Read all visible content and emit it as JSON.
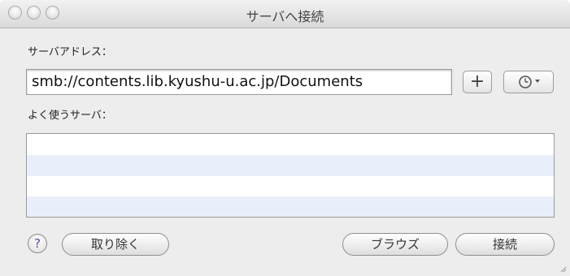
{
  "window": {
    "title": "サーバへ接続"
  },
  "labels": {
    "server_address": "サーバアドレス：",
    "favorite_servers": "よく使うサーバ："
  },
  "address": {
    "value": "smb://contents.lib.kyushu-u.ac.jp/Documents"
  },
  "buttons": {
    "add": "+",
    "help": "?",
    "remove": "取り除く",
    "browse": "ブラウズ",
    "connect": "接続"
  },
  "icons": {
    "add_favorite": "plus-icon",
    "recent_servers": "clock-icon",
    "dropdown": "chevron-down-icon",
    "help": "question-icon"
  },
  "colors": {
    "window_bg": "#ededed",
    "list_alt_row": "#e9effa",
    "help_glyph": "#6a3ea0"
  }
}
